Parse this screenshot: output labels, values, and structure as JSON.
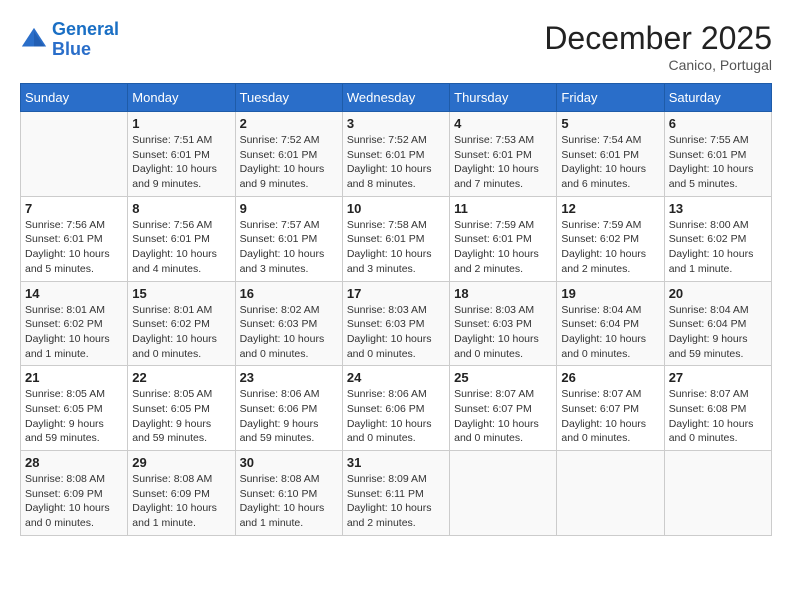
{
  "header": {
    "logo_line1": "General",
    "logo_line2": "Blue",
    "month": "December 2025",
    "location": "Canico, Portugal"
  },
  "weekdays": [
    "Sunday",
    "Monday",
    "Tuesday",
    "Wednesday",
    "Thursday",
    "Friday",
    "Saturday"
  ],
  "weeks": [
    [
      {
        "day": "",
        "sunrise": "",
        "sunset": "",
        "daylight": ""
      },
      {
        "day": "1",
        "sunrise": "Sunrise: 7:51 AM",
        "sunset": "Sunset: 6:01 PM",
        "daylight": "Daylight: 10 hours and 9 minutes."
      },
      {
        "day": "2",
        "sunrise": "Sunrise: 7:52 AM",
        "sunset": "Sunset: 6:01 PM",
        "daylight": "Daylight: 10 hours and 9 minutes."
      },
      {
        "day": "3",
        "sunrise": "Sunrise: 7:52 AM",
        "sunset": "Sunset: 6:01 PM",
        "daylight": "Daylight: 10 hours and 8 minutes."
      },
      {
        "day": "4",
        "sunrise": "Sunrise: 7:53 AM",
        "sunset": "Sunset: 6:01 PM",
        "daylight": "Daylight: 10 hours and 7 minutes."
      },
      {
        "day": "5",
        "sunrise": "Sunrise: 7:54 AM",
        "sunset": "Sunset: 6:01 PM",
        "daylight": "Daylight: 10 hours and 6 minutes."
      },
      {
        "day": "6",
        "sunrise": "Sunrise: 7:55 AM",
        "sunset": "Sunset: 6:01 PM",
        "daylight": "Daylight: 10 hours and 5 minutes."
      }
    ],
    [
      {
        "day": "7",
        "sunrise": "Sunrise: 7:56 AM",
        "sunset": "Sunset: 6:01 PM",
        "daylight": "Daylight: 10 hours and 5 minutes."
      },
      {
        "day": "8",
        "sunrise": "Sunrise: 7:56 AM",
        "sunset": "Sunset: 6:01 PM",
        "daylight": "Daylight: 10 hours and 4 minutes."
      },
      {
        "day": "9",
        "sunrise": "Sunrise: 7:57 AM",
        "sunset": "Sunset: 6:01 PM",
        "daylight": "Daylight: 10 hours and 3 minutes."
      },
      {
        "day": "10",
        "sunrise": "Sunrise: 7:58 AM",
        "sunset": "Sunset: 6:01 PM",
        "daylight": "Daylight: 10 hours and 3 minutes."
      },
      {
        "day": "11",
        "sunrise": "Sunrise: 7:59 AM",
        "sunset": "Sunset: 6:01 PM",
        "daylight": "Daylight: 10 hours and 2 minutes."
      },
      {
        "day": "12",
        "sunrise": "Sunrise: 7:59 AM",
        "sunset": "Sunset: 6:02 PM",
        "daylight": "Daylight: 10 hours and 2 minutes."
      },
      {
        "day": "13",
        "sunrise": "Sunrise: 8:00 AM",
        "sunset": "Sunset: 6:02 PM",
        "daylight": "Daylight: 10 hours and 1 minute."
      }
    ],
    [
      {
        "day": "14",
        "sunrise": "Sunrise: 8:01 AM",
        "sunset": "Sunset: 6:02 PM",
        "daylight": "Daylight: 10 hours and 1 minute."
      },
      {
        "day": "15",
        "sunrise": "Sunrise: 8:01 AM",
        "sunset": "Sunset: 6:02 PM",
        "daylight": "Daylight: 10 hours and 0 minutes."
      },
      {
        "day": "16",
        "sunrise": "Sunrise: 8:02 AM",
        "sunset": "Sunset: 6:03 PM",
        "daylight": "Daylight: 10 hours and 0 minutes."
      },
      {
        "day": "17",
        "sunrise": "Sunrise: 8:03 AM",
        "sunset": "Sunset: 6:03 PM",
        "daylight": "Daylight: 10 hours and 0 minutes."
      },
      {
        "day": "18",
        "sunrise": "Sunrise: 8:03 AM",
        "sunset": "Sunset: 6:03 PM",
        "daylight": "Daylight: 10 hours and 0 minutes."
      },
      {
        "day": "19",
        "sunrise": "Sunrise: 8:04 AM",
        "sunset": "Sunset: 6:04 PM",
        "daylight": "Daylight: 10 hours and 0 minutes."
      },
      {
        "day": "20",
        "sunrise": "Sunrise: 8:04 AM",
        "sunset": "Sunset: 6:04 PM",
        "daylight": "Daylight: 9 hours and 59 minutes."
      }
    ],
    [
      {
        "day": "21",
        "sunrise": "Sunrise: 8:05 AM",
        "sunset": "Sunset: 6:05 PM",
        "daylight": "Daylight: 9 hours and 59 minutes."
      },
      {
        "day": "22",
        "sunrise": "Sunrise: 8:05 AM",
        "sunset": "Sunset: 6:05 PM",
        "daylight": "Daylight: 9 hours and 59 minutes."
      },
      {
        "day": "23",
        "sunrise": "Sunrise: 8:06 AM",
        "sunset": "Sunset: 6:06 PM",
        "daylight": "Daylight: 9 hours and 59 minutes."
      },
      {
        "day": "24",
        "sunrise": "Sunrise: 8:06 AM",
        "sunset": "Sunset: 6:06 PM",
        "daylight": "Daylight: 10 hours and 0 minutes."
      },
      {
        "day": "25",
        "sunrise": "Sunrise: 8:07 AM",
        "sunset": "Sunset: 6:07 PM",
        "daylight": "Daylight: 10 hours and 0 minutes."
      },
      {
        "day": "26",
        "sunrise": "Sunrise: 8:07 AM",
        "sunset": "Sunset: 6:07 PM",
        "daylight": "Daylight: 10 hours and 0 minutes."
      },
      {
        "day": "27",
        "sunrise": "Sunrise: 8:07 AM",
        "sunset": "Sunset: 6:08 PM",
        "daylight": "Daylight: 10 hours and 0 minutes."
      }
    ],
    [
      {
        "day": "28",
        "sunrise": "Sunrise: 8:08 AM",
        "sunset": "Sunset: 6:09 PM",
        "daylight": "Daylight: 10 hours and 0 minutes."
      },
      {
        "day": "29",
        "sunrise": "Sunrise: 8:08 AM",
        "sunset": "Sunset: 6:09 PM",
        "daylight": "Daylight: 10 hours and 1 minute."
      },
      {
        "day": "30",
        "sunrise": "Sunrise: 8:08 AM",
        "sunset": "Sunset: 6:10 PM",
        "daylight": "Daylight: 10 hours and 1 minute."
      },
      {
        "day": "31",
        "sunrise": "Sunrise: 8:09 AM",
        "sunset": "Sunset: 6:11 PM",
        "daylight": "Daylight: 10 hours and 2 minutes."
      },
      {
        "day": "",
        "sunrise": "",
        "sunset": "",
        "daylight": ""
      },
      {
        "day": "",
        "sunrise": "",
        "sunset": "",
        "daylight": ""
      },
      {
        "day": "",
        "sunrise": "",
        "sunset": "",
        "daylight": ""
      }
    ]
  ]
}
